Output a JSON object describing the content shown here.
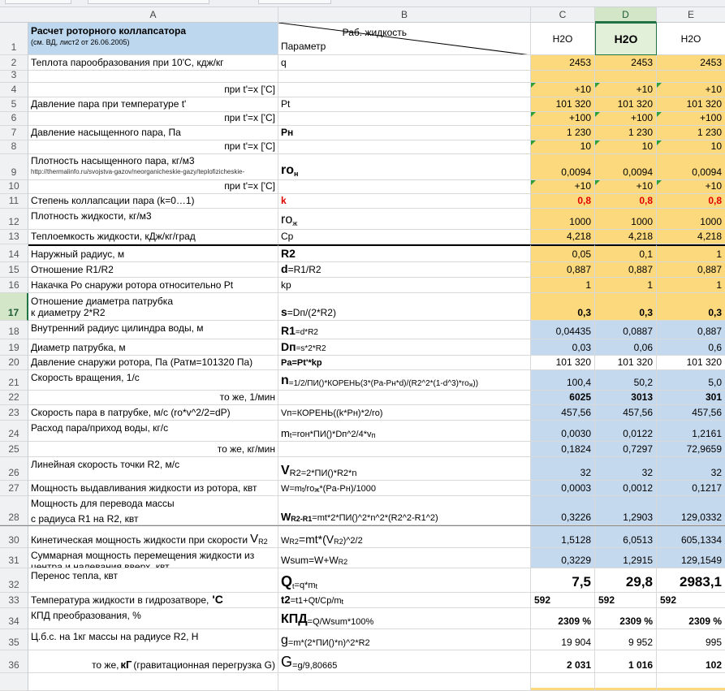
{
  "columns": {
    "a": "A",
    "b": "B",
    "c": "C",
    "d": "D",
    "e": "E"
  },
  "header": {
    "title": "Расчет роторного коллапсатора",
    "subtitle": "(см. ВД, лист2 от 26.06.2005)",
    "b_top": "Раб. жидкость",
    "b_bottom": "Параметр",
    "c": "H2O",
    "d": "H2O",
    "e": "H2O"
  },
  "rows": [
    {
      "n": "2",
      "a": "Теплота парообразования при 10'С, кдж/кг",
      "b": "q",
      "c": "2453",
      "d": "2453",
      "e": "2453"
    },
    {
      "n": "3",
      "a": "",
      "b": "",
      "c": "",
      "d": "",
      "e": ""
    },
    {
      "n": "4",
      "a": "при t'=x ['С]",
      "b": "",
      "c": "+10",
      "d": "+10",
      "e": "+10"
    },
    {
      "n": "5",
      "a": "Давление пара при температуре t'",
      "b": "Pt",
      "c": "101 320",
      "d": "101 320",
      "e": "101 320"
    },
    {
      "n": "6",
      "a": "при t'=x ['С]",
      "b": "",
      "c": "+100",
      "d": "+100",
      "e": "+100"
    },
    {
      "n": "7",
      "a": "Давление насыщенного пара, Па",
      "b": "Pн",
      "c": "1 230",
      "d": "1 230",
      "e": "1 230"
    },
    {
      "n": "8",
      "a": "при t'=x ['С]",
      "b": "",
      "c": "10",
      "d": "10",
      "e": "10"
    },
    {
      "n": "9",
      "a": "Плотность насыщенного пара, кг/м3",
      "a2": "http://thermalinfo.ru/svojstva-gazov/neorganicheskie-gazy/teplofizicheskie-",
      "b": "ro",
      "b_sub": "н",
      "c": "0,0094",
      "d": "0,0094",
      "e": "0,0094"
    },
    {
      "n": "10",
      "a": "при t'=x ['С]",
      "b": "",
      "c": "+10",
      "d": "+10",
      "e": "+10"
    },
    {
      "n": "11",
      "a": "Степень коллапсации пара (k=0…1)",
      "b": "k",
      "c": "0,8",
      "d": "0,8",
      "e": "0,8"
    },
    {
      "n": "12",
      "a": "Плотность жидкости, кг/м3",
      "b": "ro",
      "b_sub": "ж",
      "c": "1000",
      "d": "1000",
      "e": "1000"
    },
    {
      "n": "13",
      "a": "Теплоемкость жидкости, кДж/кг/град",
      "b": "Cp",
      "c": "4,218",
      "d": "4,218",
      "e": "4,218"
    },
    {
      "n": "14",
      "a": "Наружный радиус, м",
      "b": "R2",
      "c": "0,05",
      "d": "0,1",
      "e": "1"
    },
    {
      "n": "15",
      "a": "Отношение R1/R2",
      "b": "d",
      "b_rest": "=R1/R2",
      "c": "0,887",
      "d": "0,887",
      "e": "0,887"
    },
    {
      "n": "16",
      "a": "Накачка Ро снаружи ротора относительно Pt",
      "b": "kp",
      "c": "1",
      "d": "1",
      "e": "1"
    },
    {
      "n": "17",
      "a": "Отношение диаметра патрубка",
      "a2": "к диаметру  2*R2",
      "b": "s",
      "b_rest": "=Dп/(2*R2)",
      "c": "0,3",
      "d": "0,3",
      "e": "0,3"
    },
    {
      "n": "18",
      "a": "Внутренний радиус цилиндра воды, м",
      "b": "R1",
      "b_rest": "=d*R2",
      "c": "0,04435",
      "d": "0,0887",
      "e": "0,887"
    },
    {
      "n": "19",
      "a": "Диаметр патрубка, м",
      "b": "Dп",
      "b_rest": "=s*2*R2",
      "c": "0,03",
      "d": "0,06",
      "e": "0,6"
    },
    {
      "n": "20",
      "a": "Давление снаружи ротора, Па (Ратм=101320 Па)",
      "b": "Pa=Pt'*kp",
      "c": "101 320",
      "d": "101 320",
      "e": "101 320"
    },
    {
      "n": "21",
      "a": "Скорость вращения, 1/с",
      "b": "n",
      "b_rest": "=1/2/ПИ()*КОРЕНЬ(3*(Pa-Pн*d)/(R2^2*(1-d^3)*ro",
      "b_sub": "ж",
      "b_end": "))",
      "c": "100,4",
      "d": "50,2",
      "e": "5,0"
    },
    {
      "n": "22",
      "a": "то же, 1/мин",
      "b": "",
      "c": "6025",
      "d": "3013",
      "e": "301"
    },
    {
      "n": "23",
      "a": "Скорость пара в патрубке, м/с (ro*v^2/2=dP)",
      "b": "Vп=КОРЕНЬ((k*Pн)*2/ro)",
      "c": "457,56",
      "d": "457,56",
      "e": "457,56"
    },
    {
      "n": "24",
      "a": "Расход пара/приход воды, кг/с",
      "b": "m",
      "b_sub": "t",
      "b_rest": "=roн*ПИ()*Dп^2/4*v",
      "b_sub2": "п",
      "c": "0,0030",
      "d": "0,0122",
      "e": "1,2161"
    },
    {
      "n": "25",
      "a": "то же, кг/мин",
      "b": "",
      "c": "0,1824",
      "d": "0,7297",
      "e": "72,9659"
    },
    {
      "n": "26",
      "a": "Линейная скорость точки R2, м/с",
      "b": "V",
      "b_sub": "R2",
      "b_rest": "=2*ПИ()*R2*n",
      "c": "32",
      "d": "32",
      "e": "32"
    },
    {
      "n": "27",
      "a": "Мощность выдавливания жидкости из ротора, квт",
      "b": "W=m",
      "b_sub": "t",
      "b_rest": "/ro",
      "b_sub2": "ж",
      "b_end": "*(Pa-Pн)/1000",
      "c": "0,0003",
      "d": "0,0012",
      "e": "0,1217"
    },
    {
      "n": "28",
      "a": "Мощность для перевода массы",
      "a2": "с радиуса R1 на R2, квт",
      "b": "W",
      "b_sub": "R2-R1",
      "b_rest": "=mt*2*ПИ()^2*n^2*(R2^2-R1^2)",
      "c": "0,3226",
      "d": "1,2903",
      "e": "129,0332"
    },
    {
      "n": "30",
      "a": "Кинетическая мощность жидкости при скорости",
      "a_big": "V",
      "a_sub": "R2",
      "b": "W",
      "b_sub": "R2",
      "b_rest": "=mt*(V",
      "b_sub2": "R2",
      "b_end": ")^2/2",
      "c": "1,5128",
      "d": "6,0513",
      "e": "605,1334"
    },
    {
      "n": "31",
      "a": "Суммарная мощность перемещения жидкости из",
      "a2": "центра и налевания вверх, квт",
      "b": "Wsum=W+W",
      "b_sub": "R2",
      "c": "0,3229",
      "d": "1,2915",
      "e": "129,1549"
    },
    {
      "n": "32",
      "a": "Перенос тепла, квт",
      "b": "Q",
      "b_sub": "t",
      "b_rest": "=q*m",
      "b_sub2": "t",
      "c": "7,5",
      "d": "29,8",
      "e": "2983,1"
    },
    {
      "n": "33",
      "a": "Температура жидкости в гидрозатворе,",
      "a_big": "'С",
      "b": "t2",
      "b_rest": "=t1+Qt/Cp/m",
      "b_sub": "t",
      "c": "592",
      "d": "592",
      "e": "592"
    },
    {
      "n": "34",
      "a": "КПД преобразования, %",
      "b": "КПД",
      "b_rest": "=Q/Wsum*100%",
      "c": "2309 %",
      "d": "2309 %",
      "e": "2309 %"
    },
    {
      "n": "35",
      "a": "Ц.б.с. на 1кг массы на радиусе R2, Н",
      "b": "g",
      "b_rest": "=m*(2*ПИ()*n)^2*R2",
      "c": "19 904",
      "d": "9 952",
      "e": "995"
    },
    {
      "n": "36",
      "a": "то же,",
      "a_big": "кГ",
      "a_rest": "(гравитационная перегрузка G)",
      "b": "G",
      "b_rest": "=g/9,80665",
      "c": "2 031",
      "d": "1 016",
      "e": "102"
    }
  ]
}
